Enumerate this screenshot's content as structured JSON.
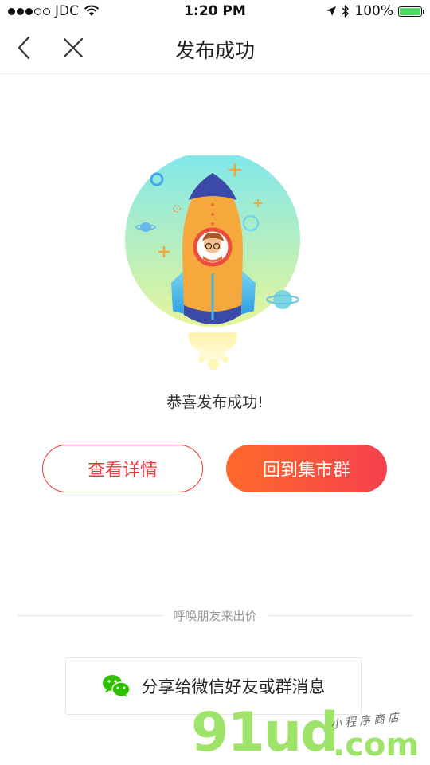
{
  "status_bar": {
    "carrier": "JDC",
    "time": "1:20 PM",
    "battery": "100%"
  },
  "nav": {
    "title": "发布成功"
  },
  "main": {
    "success_message": "恭喜发布成功!",
    "details_button": "查看详情",
    "back_button": "回到集市群"
  },
  "share": {
    "divider_text": "呼唤朋友来出价",
    "share_label": "分享给微信好友或群消息"
  },
  "watermark": {
    "main": "91ud",
    "tld": ".com",
    "tagline": "小程序商店"
  },
  "colors": {
    "accent_red": "#f3343b",
    "accent_orange": "#ff6a2b",
    "wechat_green": "#2dc100",
    "battery_green": "#4cd964"
  }
}
